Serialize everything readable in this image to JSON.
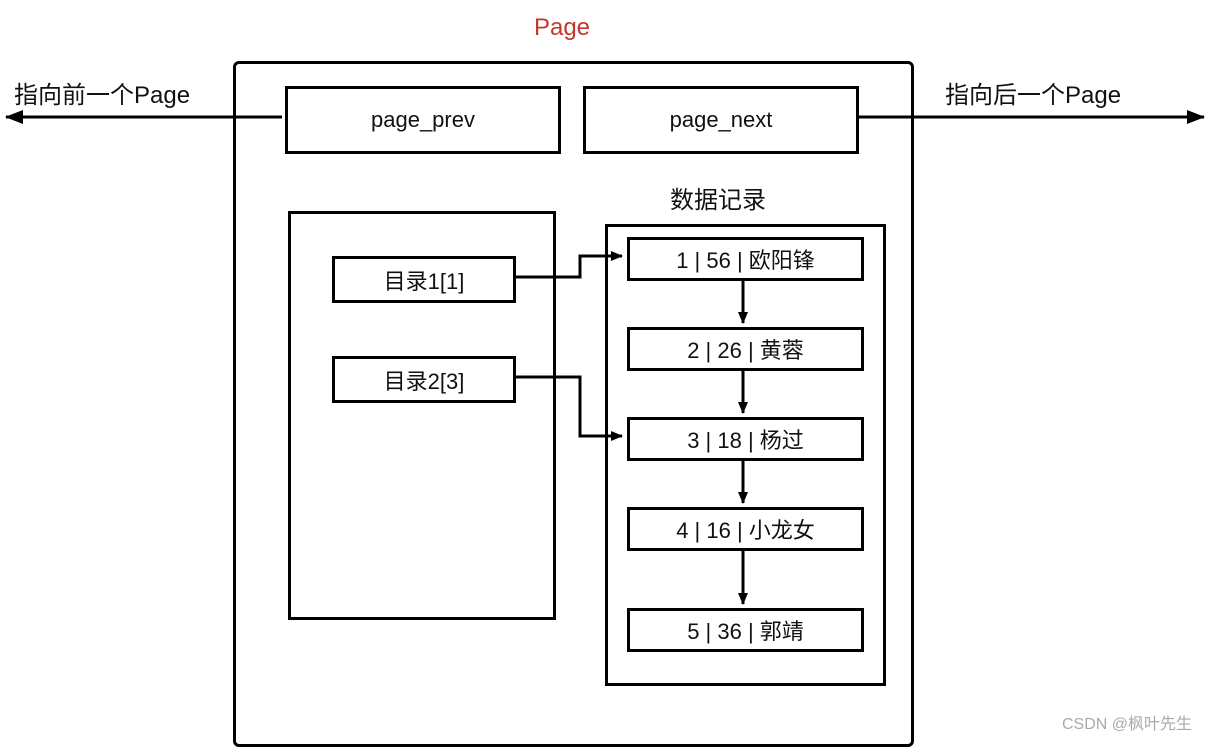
{
  "title": "Page",
  "labels": {
    "prev_arrow": "指向前一个Page",
    "next_arrow": "指向后一个Page",
    "records_title": "数据记录"
  },
  "headers": {
    "prev": "page_prev",
    "next": "page_next"
  },
  "directories": [
    {
      "label": "目录1[1]"
    },
    {
      "label": "目录2[3]"
    }
  ],
  "records": [
    {
      "text": "1 | 56 | 欧阳锋"
    },
    {
      "text": "2 | 26 | 黄蓉"
    },
    {
      "text": "3 | 18 | 杨过"
    },
    {
      "text": "4 | 16 | 小龙女"
    },
    {
      "text": "5 | 36 | 郭靖"
    }
  ],
  "watermark": "CSDN @枫叶先生"
}
